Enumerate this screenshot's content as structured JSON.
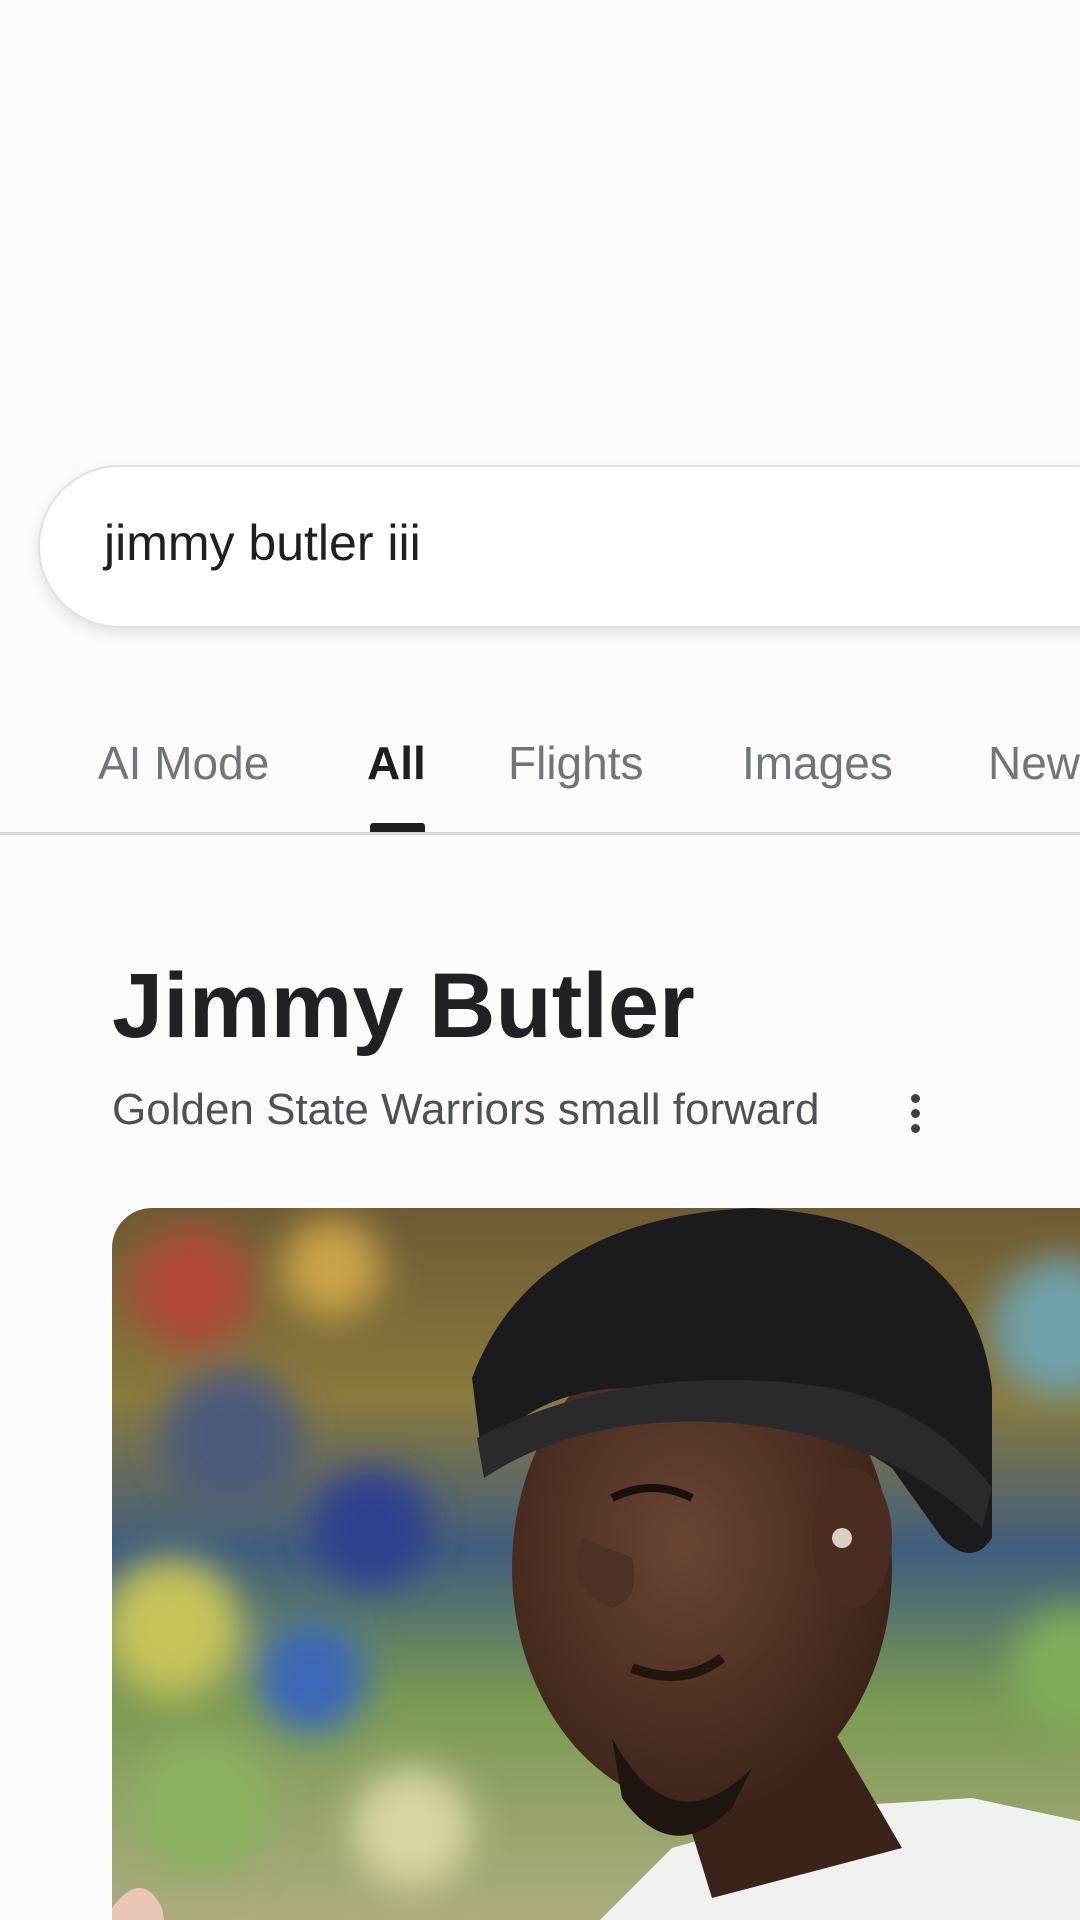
{
  "search": {
    "query": "jimmy butler iii"
  },
  "tabs": [
    {
      "label": "AI Mode",
      "active": false
    },
    {
      "label": "All",
      "active": true
    },
    {
      "label": "Flights",
      "active": false
    },
    {
      "label": "Images",
      "active": false
    },
    {
      "label": "New",
      "active": false
    }
  ],
  "entity": {
    "title": "Jimmy Butler",
    "subtitle": "Golden State Warriors small forward",
    "more_icon": "more-vert-icon"
  },
  "photo": {
    "subject": "entity-photo"
  },
  "colors": {
    "background": "#fdfcfd",
    "text_primary": "#1f1f1f",
    "text_secondary": "#70757a",
    "divider": "#dadce0"
  }
}
